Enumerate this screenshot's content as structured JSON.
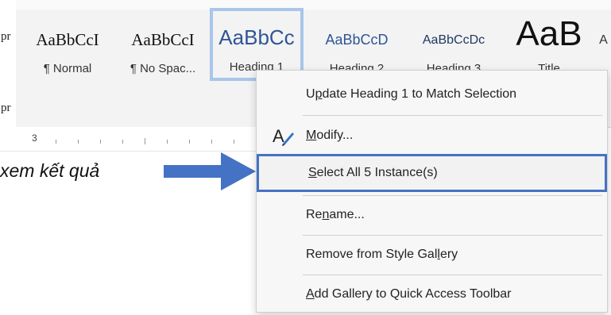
{
  "doc": {
    "fragment_top": "pr",
    "fragment_bottom": "pr",
    "ruler_number": "3",
    "annotation": "xem kết quả"
  },
  "gallery": {
    "items": [
      {
        "preview": "AaBbCcI",
        "name": "¶ Normal"
      },
      {
        "preview": "AaBbCcI",
        "name": "¶ No Spac..."
      },
      {
        "preview": "AaBbCc",
        "name": "Heading 1",
        "selected": true
      },
      {
        "preview": "AaBbCcD",
        "name": "Heading 2"
      },
      {
        "preview": "AaBbCcDc",
        "name": "Heading 3"
      },
      {
        "preview": "AaB",
        "name": "Title"
      },
      {
        "preview": "A",
        "name": ""
      }
    ]
  },
  "menu": {
    "items": [
      {
        "label": "Update Heading 1 to Match Selection",
        "mnemonic_index": 1
      },
      {
        "label": "Modify...",
        "mnemonic_index": 0,
        "icon": "modify-style-icon"
      },
      {
        "label": "Select All 5 Instance(s)",
        "mnemonic_index": 0,
        "highlighted": true
      },
      {
        "label": "Rename...",
        "mnemonic_index": 2
      },
      {
        "label": "Remove from Style Gallery",
        "mnemonic_index": 21
      },
      {
        "label": "Add Gallery to Quick Access Toolbar",
        "mnemonic_index": 0
      }
    ]
  },
  "colors": {
    "accent": "#4472c4",
    "heading_text": "#2f5597",
    "selected_border": "#a9c6ea",
    "arrow": "#4472c4"
  }
}
